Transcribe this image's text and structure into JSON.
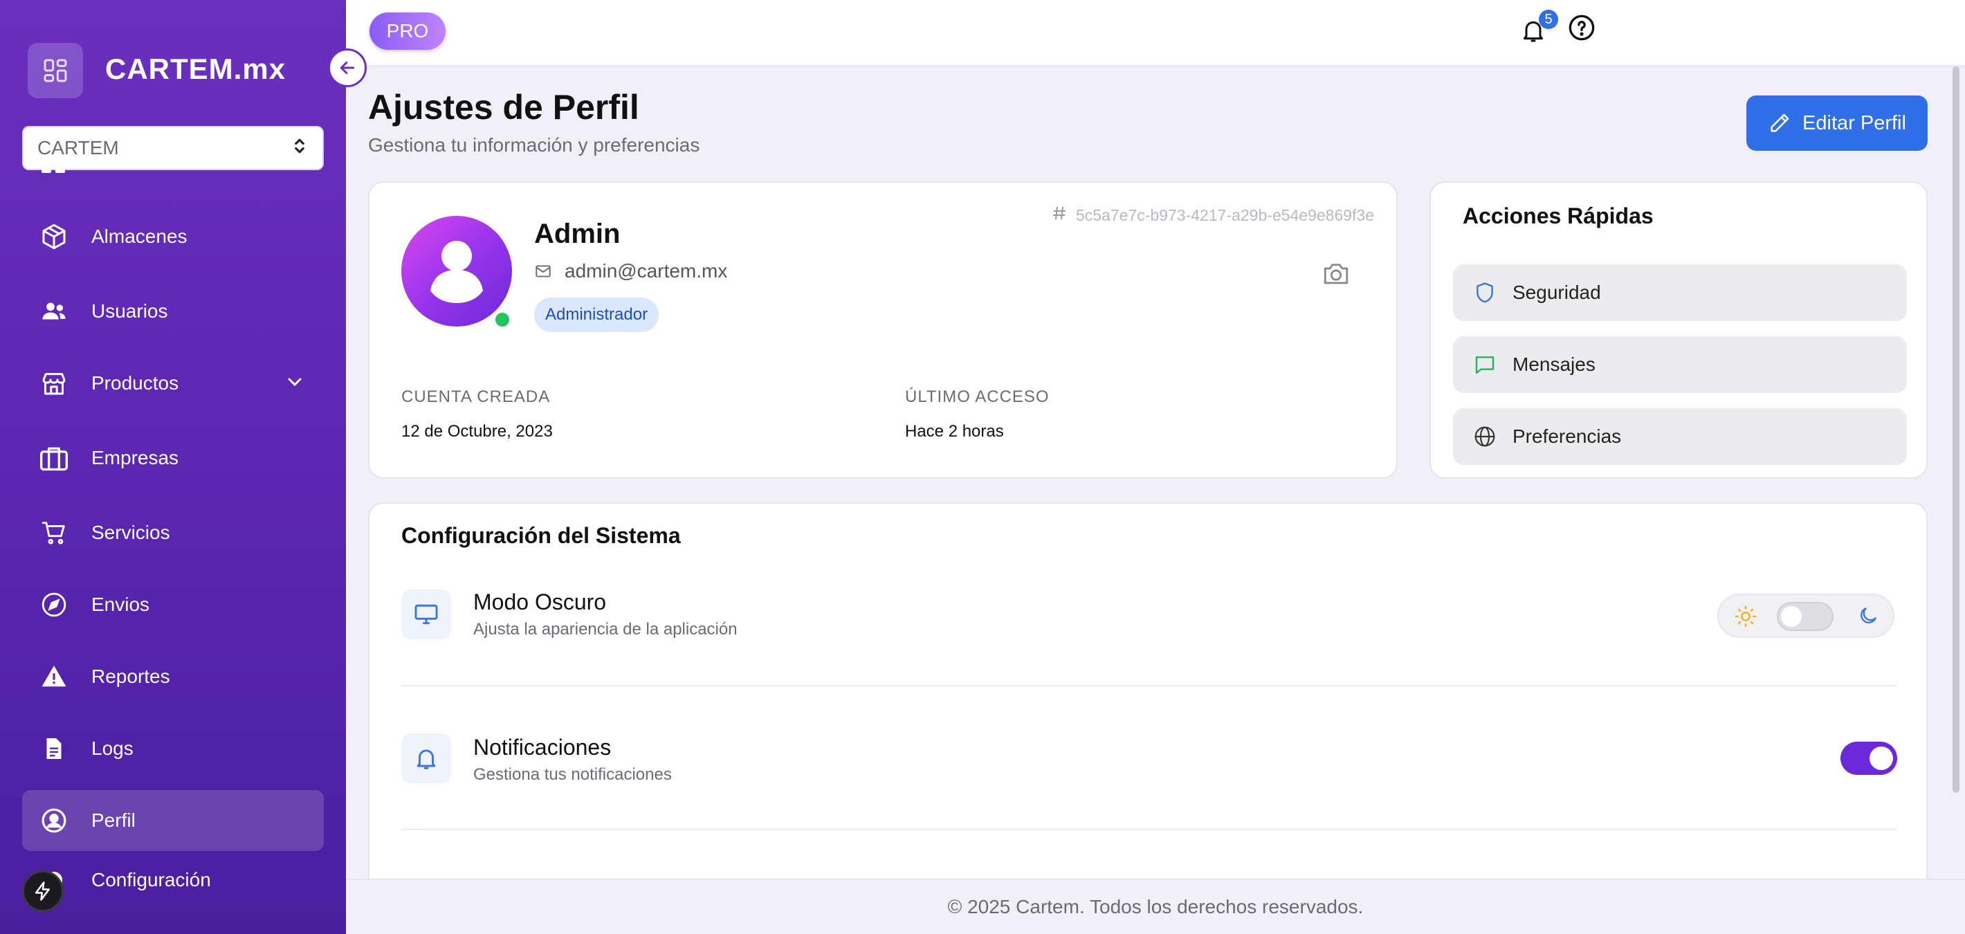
{
  "sidebar": {
    "logo_text": "CARTEM.mx",
    "company_select": "CARTEM",
    "items": [
      {
        "label": "Almacenes",
        "icon": "box-icon"
      },
      {
        "label": "Usuarios",
        "icon": "users-icon"
      },
      {
        "label": "Productos",
        "icon": "store-icon"
      },
      {
        "label": "Empresas",
        "icon": "briefcase-icon"
      },
      {
        "label": "Servicios",
        "icon": "cart-icon"
      },
      {
        "label": "Envios",
        "icon": "compass-icon"
      },
      {
        "label": "Reportes",
        "icon": "warning-icon"
      },
      {
        "label": "Logs",
        "icon": "document-icon"
      },
      {
        "label": "Perfil",
        "icon": "user-circle-icon"
      },
      {
        "label": "Configuración",
        "icon": "gear-icon"
      }
    ],
    "active_item": "Perfil"
  },
  "topbar": {
    "plan_badge": "PRO",
    "notification_count": "5"
  },
  "header": {
    "title": "Ajustes de Perfil",
    "subtitle": "Gestiona tu información y preferencias",
    "edit_button": "Editar Perfil"
  },
  "profile": {
    "name": "Admin",
    "email": "admin@cartem.mx",
    "role": "Administrador",
    "user_id": "5c5a7e7c-b973-4217-a29b-e54e9e869f3e",
    "created_label": "CUENTA CREADA",
    "created_value": "12 de Octubre, 2023",
    "last_access_label": "ÚLTIMO ACCESO",
    "last_access_value": "Hace 2 horas",
    "status": "online"
  },
  "quick_actions": {
    "title": "Acciones Rápidas",
    "items": [
      {
        "label": "Seguridad",
        "icon": "shield-icon"
      },
      {
        "label": "Mensajes",
        "icon": "message-icon"
      },
      {
        "label": "Preferencias",
        "icon": "globe-icon"
      }
    ]
  },
  "system": {
    "title": "Configuración del Sistema",
    "dark_mode": {
      "label": "Modo Oscuro",
      "description": "Ajusta la apariencia de la aplicación",
      "enabled": false
    },
    "notifications": {
      "label": "Notificaciones",
      "description": "Gestiona tus notificaciones",
      "enabled": true
    }
  },
  "footer": {
    "text": "© 2025 Cartem. Todos los derechos reservados."
  },
  "colors": {
    "sidebar": "#5a26b0",
    "primary_button": "#2f6fe8",
    "toggle_on": "#6d28d9",
    "online": "#22c55e"
  }
}
